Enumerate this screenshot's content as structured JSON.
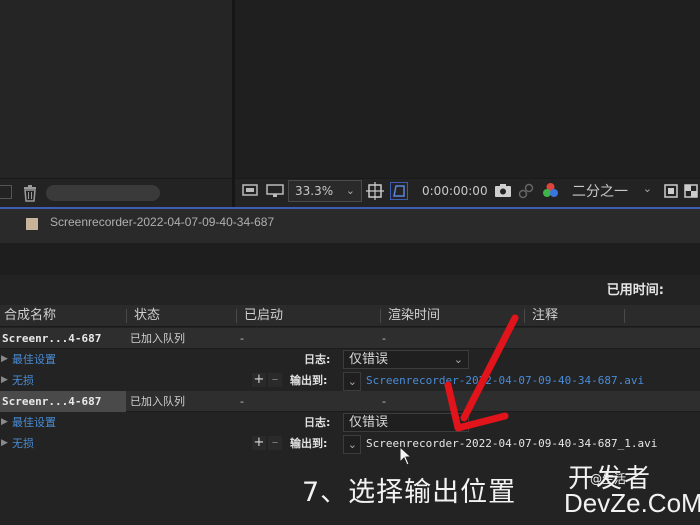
{
  "viewer_bar": {
    "zoom": "33.3%",
    "timecode": "0:00:00:00",
    "resolution": "二分之一"
  },
  "project": {
    "composition_name": "Screenrecorder-2022-04-07-09-40-34-687"
  },
  "render_queue": {
    "elapsed_label": "已用时间:",
    "columns": [
      "合成名称",
      "状态",
      "已启动",
      "渲染时间",
      "注释"
    ],
    "items": [
      {
        "name": "Screenr...4-687",
        "status": "已加入队列",
        "started": "-",
        "render_time": "-",
        "render_settings": "最佳设置",
        "output_module": "无损",
        "log_label": "日志:",
        "log_value": "仅错误",
        "output_to_label": "输出到:",
        "output_file": "Screenrecorder-2022-04-07-09-40-34-687.avi"
      },
      {
        "name": "Screenr...4-687",
        "status": "已加入队列",
        "started": "-",
        "render_time": "-",
        "render_settings": "最佳设置",
        "output_module": "无损",
        "log_label": "日志:",
        "log_value": "仅错误",
        "output_to_label": "输出到:",
        "output_file": "Screenrecorder-2022-04-07-09-40-34-687_1.avi"
      }
    ]
  },
  "caption": "7、选择输出位置",
  "watermark": {
    "line1": "开发者",
    "line2": "DevZe.CoM",
    "small": "@生活"
  },
  "colors": {
    "accent_blue": "#3d5db5",
    "link_blue": "#4a8cd6",
    "arrow_red": "#e0141a"
  }
}
